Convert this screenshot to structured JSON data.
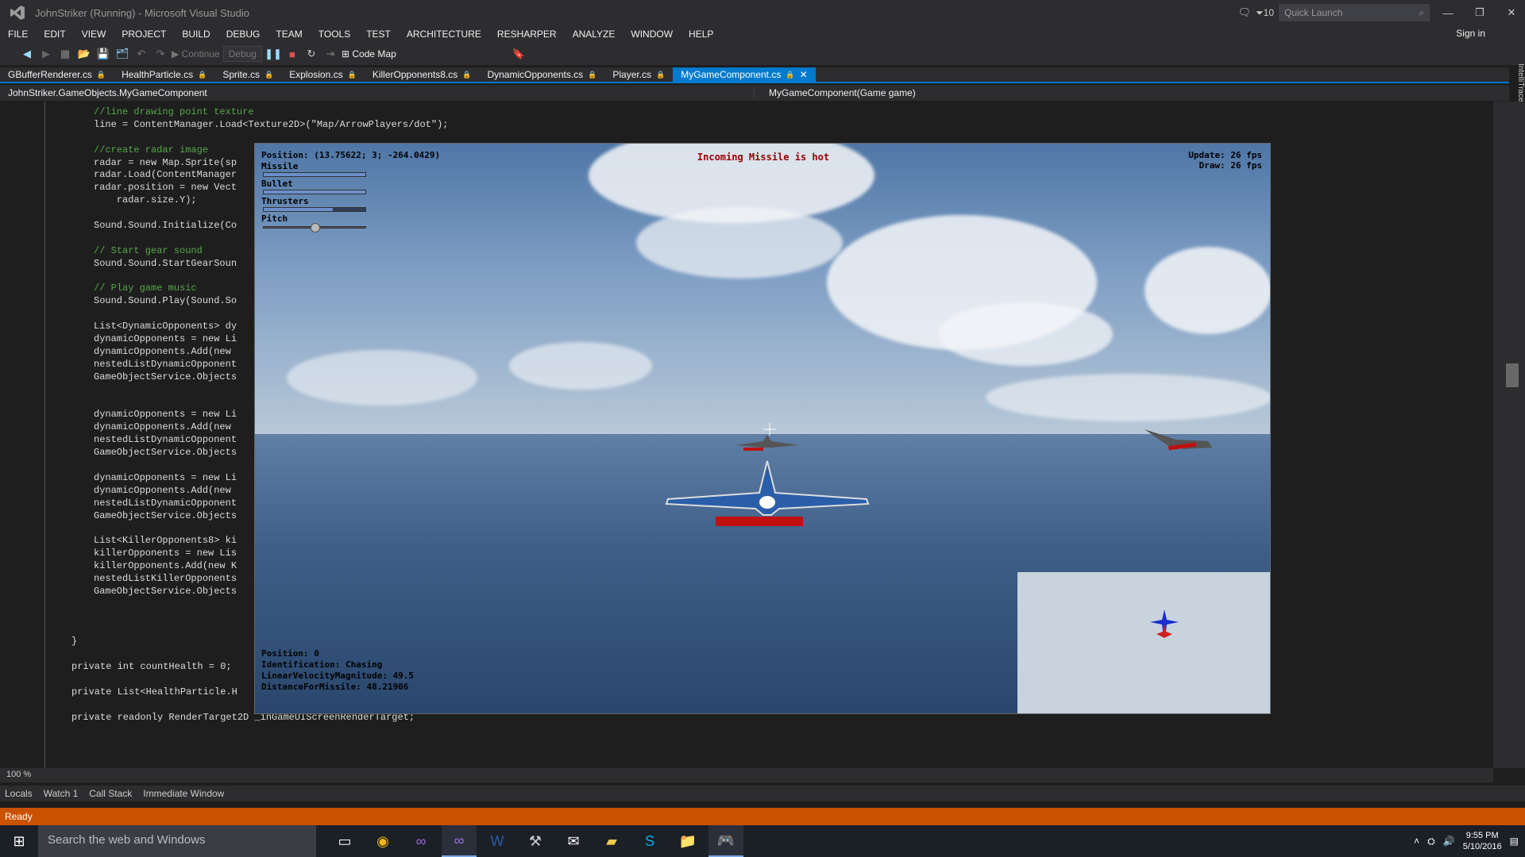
{
  "titlebar": {
    "title": "JohnStriker (Running) - Microsoft Visual Studio",
    "notif_count": "10",
    "quick_launch_placeholder": "Quick Launch"
  },
  "menu": [
    "FILE",
    "EDIT",
    "VIEW",
    "PROJECT",
    "BUILD",
    "DEBUG",
    "TEAM",
    "TOOLS",
    "TEST",
    "ARCHITECTURE",
    "RESHARPER",
    "ANALYZE",
    "WINDOW",
    "HELP"
  ],
  "signin": "Sign in",
  "toolbar": {
    "continue": "Continue",
    "config": "Debug",
    "codemap": "Code Map"
  },
  "tabs": [
    "GBufferRenderer.cs",
    "HealthParticle.cs",
    "Sprite.cs",
    "Explosion.cs",
    "KillerOpponents8.cs",
    "DynamicOpponents.cs",
    "Player.cs",
    "MyGameComponent.cs"
  ],
  "nav": {
    "left": "JohnStriker.GameObjects.MyGameComponent",
    "right": "MyGameComponent(Game game)"
  },
  "zoom": "100 %",
  "bottom_tabs": [
    "Locals",
    "Watch 1",
    "Call Stack",
    "Immediate Window"
  ],
  "status": "Ready",
  "taskbar": {
    "search": "Search the web and Windows",
    "time": "9:55 PM",
    "date": "5/10/2016"
  },
  "game": {
    "position": "Position: (13.75622; 3; -264.0429)",
    "warning": "Incoming Missile is hot",
    "update": "Update: 26 fps",
    "draw": "Draw: 26 fps",
    "bars": [
      {
        "label": "Missile",
        "value": 1.0
      },
      {
        "label": "Bullet",
        "value": 1.0
      },
      {
        "label": "Thrusters",
        "value": 0.68
      },
      {
        "label": "Pitch",
        "value": 0.5
      }
    ],
    "info": [
      "Position: 0",
      "Identification: Chasing",
      "LinearVelocityMagnitude: 49.5",
      "DistanceForMissile: 48.21906"
    ]
  },
  "code": [
    {
      "t": "//line drawing point texture",
      "c": "cm"
    },
    {
      "t": "line = ContentManager.Load<Texture2D>(\"Map/ArrowPlayers/dot\");",
      "c": ""
    },
    {
      "t": "",
      "c": ""
    },
    {
      "t": "//create radar image",
      "c": "cm"
    },
    {
      "t": "radar = new Map.Sprite(sp",
      "c": ""
    },
    {
      "t": "radar.Load(ContentManager",
      "c": ""
    },
    {
      "t": "radar.position = new Vect",
      "c": ""
    },
    {
      "t": "    radar.size.Y);",
      "c": ""
    },
    {
      "t": "",
      "c": ""
    },
    {
      "t": "Sound.Sound.Initialize(Co",
      "c": ""
    },
    {
      "t": "",
      "c": ""
    },
    {
      "t": "// Start gear sound",
      "c": "cm"
    },
    {
      "t": "Sound.Sound.StartGearSoun",
      "c": ""
    },
    {
      "t": "",
      "c": ""
    },
    {
      "t": "// Play game music",
      "c": "cm"
    },
    {
      "t": "Sound.Sound.Play(Sound.So",
      "c": ""
    },
    {
      "t": "",
      "c": ""
    },
    {
      "t": "List<DynamicOpponents> dy",
      "c": ""
    },
    {
      "t": "dynamicOpponents = new Li",
      "c": ""
    },
    {
      "t": "dynamicOpponents.Add(new ",
      "c": ""
    },
    {
      "t": "nestedListDynamicOpponent",
      "c": ""
    },
    {
      "t": "GameObjectService.Objects",
      "c": ""
    },
    {
      "t": "",
      "c": ""
    },
    {
      "t": "",
      "c": ""
    },
    {
      "t": "dynamicOpponents = new Li",
      "c": ""
    },
    {
      "t": "dynamicOpponents.Add(new ",
      "c": ""
    },
    {
      "t": "nestedListDynamicOpponent",
      "c": ""
    },
    {
      "t": "GameObjectService.Objects",
      "c": ""
    },
    {
      "t": "",
      "c": ""
    },
    {
      "t": "dynamicOpponents = new Li",
      "c": ""
    },
    {
      "t": "dynamicOpponents.Add(new ",
      "c": ""
    },
    {
      "t": "nestedListDynamicOpponent",
      "c": ""
    },
    {
      "t": "GameObjectService.Objects",
      "c": ""
    },
    {
      "t": "",
      "c": ""
    },
    {
      "t": "List<KillerOpponents8> ki",
      "c": ""
    },
    {
      "t": "killerOpponents = new Lis",
      "c": ""
    },
    {
      "t": "killerOpponents.Add(new K",
      "c": ""
    },
    {
      "t": "nestedListKillerOpponents",
      "c": ""
    },
    {
      "t": "GameObjectService.Objects",
      "c": ""
    },
    {
      "t": "",
      "c": ""
    },
    {
      "t": "",
      "c": ""
    },
    {
      "t": "",
      "c": ""
    },
    {
      "t": "}",
      "c": "",
      "o": -1
    },
    {
      "t": "",
      "c": ""
    },
    {
      "t": "private int countHealth = 0;",
      "c": "",
      "o": -1
    },
    {
      "t": "",
      "c": ""
    },
    {
      "t": "private List<HealthParticle.H",
      "c": "",
      "o": -1
    },
    {
      "t": "",
      "c": ""
    },
    {
      "t": "private readonly RenderTarget2D _inGameUIScreenRenderTarget;",
      "c": "",
      "o": -1
    }
  ]
}
